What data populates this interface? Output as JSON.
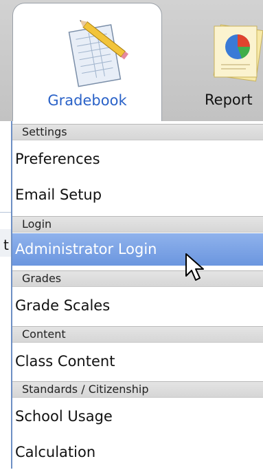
{
  "toolbar": {
    "tabs": [
      {
        "label": "Gradebook",
        "icon": "gradebook-icon",
        "active": true
      },
      {
        "label": "Report",
        "icon": "report-icon",
        "active": false
      }
    ]
  },
  "background_page": {
    "fragment_text": "t"
  },
  "menu": {
    "sections": [
      {
        "header": "Settings",
        "items": [
          "Preferences",
          "Email Setup"
        ]
      },
      {
        "header": "Login",
        "items": [
          "Administrator Login"
        ]
      },
      {
        "header": "Grades",
        "items": [
          "Grade Scales"
        ]
      },
      {
        "header": "Content",
        "items": [
          "Class Content"
        ]
      },
      {
        "header": "Standards / Citizenship",
        "items": [
          "School Usage",
          "Calculation"
        ]
      }
    ],
    "hovered_item": "Administrator Login"
  },
  "colors": {
    "accent": "#2a62c8",
    "hover_highlight": "#6b96df",
    "menu_border": "#6d8fc4",
    "header_bg": "#d6d6d6"
  }
}
